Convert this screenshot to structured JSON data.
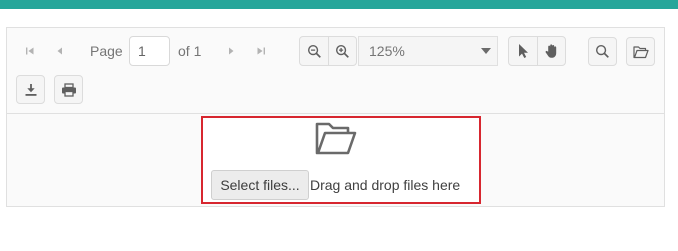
{
  "colors": {
    "topbar": "#26a69a",
    "dropzone_border": "#d7262f"
  },
  "toolbar": {
    "navigation": {
      "first_icon": "first-page-icon",
      "previous_icon": "previous-page-icon",
      "page_label": "Page",
      "page_value": "1",
      "of_label": "of 1",
      "next_icon": "next-page-icon",
      "last_icon": "last-page-icon"
    },
    "zoom": {
      "zoom_out_icon": "zoom-out-icon",
      "zoom_in_icon": "zoom-in-icon",
      "zoom_value": "125%",
      "dropdown_icon": "caret-down-icon"
    },
    "interaction": {
      "select_icon": "pointer-icon",
      "pan_icon": "hand-icon"
    },
    "actions": {
      "search_icon": "search-icon",
      "open_icon": "folder-open-icon",
      "download_icon": "download-icon",
      "print_icon": "print-icon"
    }
  },
  "upload": {
    "icon": "folder-open-icon",
    "select_button_label": "Select files...",
    "drop_text": "Drag and drop files here"
  }
}
